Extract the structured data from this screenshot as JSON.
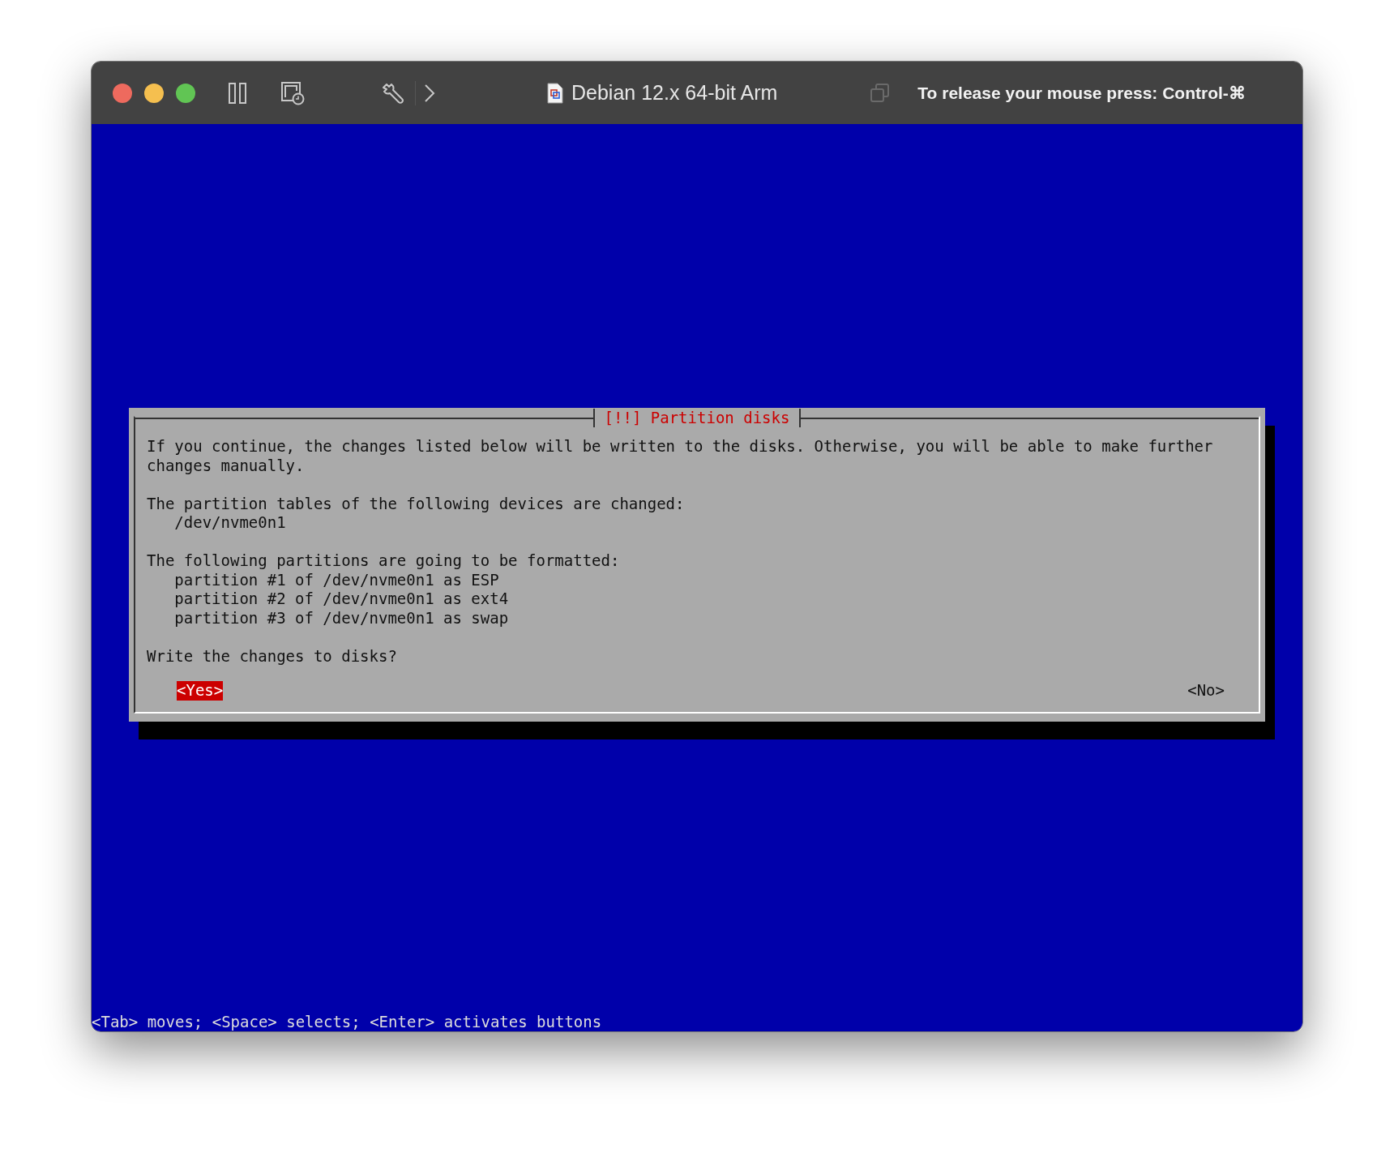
{
  "window": {
    "title": "Debian 12.x 64-bit Arm",
    "release_hint": "To release your mouse press: Control-⌘"
  },
  "dialog": {
    "title": "[!!] Partition disks",
    "intro": "If you continue, the changes listed below will be written to the disks. Otherwise, you will be able to make further changes manually.",
    "sections": [
      {
        "heading": "The partition tables of the following devices are changed:",
        "items": [
          "/dev/nvme0n1"
        ]
      },
      {
        "heading": "The following partitions are going to be formatted:",
        "items": [
          "partition #1 of /dev/nvme0n1 as ESP",
          "partition #2 of /dev/nvme0n1 as ext4",
          "partition #3 of /dev/nvme0n1 as swap"
        ]
      }
    ],
    "question": "Write the changes to disks?",
    "buttons": [
      {
        "label": "<Yes>",
        "selected": true
      },
      {
        "label": "<No>",
        "selected": false
      }
    ]
  },
  "help_line": "<Tab> moves; <Space> selects; <Enter> activates buttons"
}
